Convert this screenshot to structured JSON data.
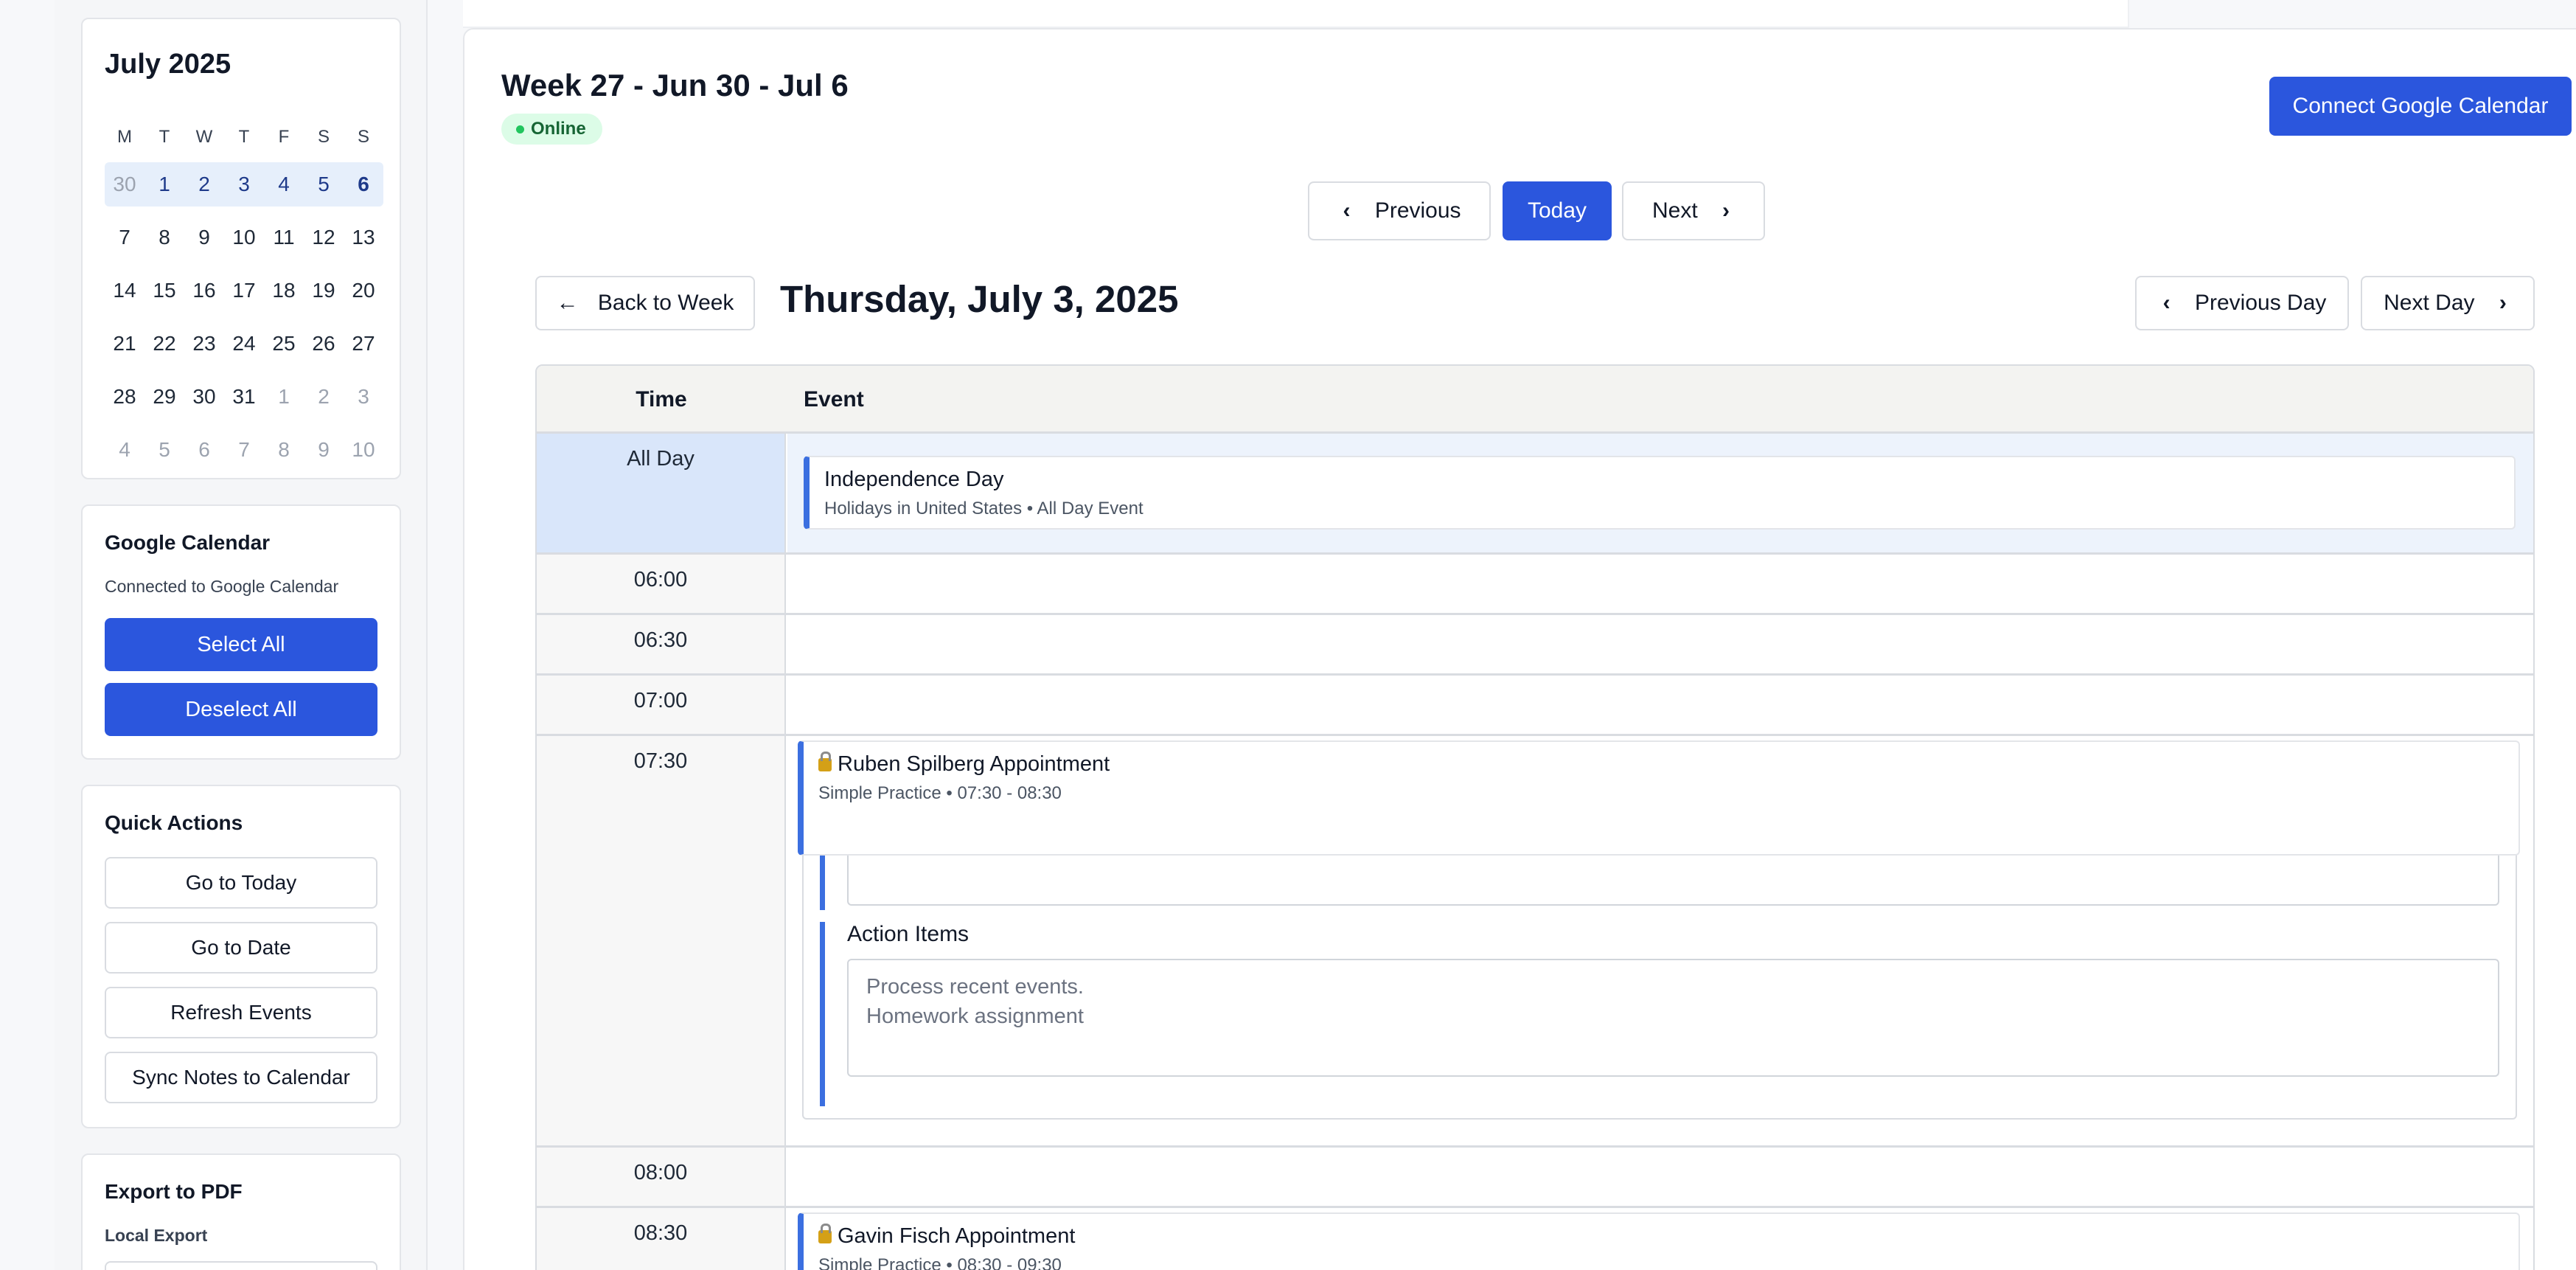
{
  "sidebar": {
    "mini_calendar": {
      "title": "July 2025",
      "weekdays": [
        "M",
        "T",
        "W",
        "T",
        "F",
        "S",
        "S"
      ],
      "weeks": [
        [
          "30",
          "1",
          "2",
          "3",
          "4",
          "5",
          "6"
        ],
        [
          "7",
          "8",
          "9",
          "10",
          "11",
          "12",
          "13"
        ],
        [
          "14",
          "15",
          "16",
          "17",
          "18",
          "19",
          "20"
        ],
        [
          "21",
          "22",
          "23",
          "24",
          "25",
          "26",
          "27"
        ],
        [
          "28",
          "29",
          "30",
          "31",
          "1",
          "2",
          "3"
        ],
        [
          "4",
          "5",
          "6",
          "7",
          "8",
          "9",
          "10"
        ]
      ]
    },
    "google_calendar": {
      "title": "Google Calendar",
      "status": "Connected to Google Calendar",
      "select_all": "Select All",
      "deselect_all": "Deselect All"
    },
    "quick_actions": {
      "title": "Quick Actions",
      "go_today": "Go to Today",
      "go_date": "Go to Date",
      "refresh": "Refresh Events",
      "sync_notes": "Sync Notes to Calendar"
    },
    "export_pdf": {
      "title": "Export to PDF",
      "local_export": "Local Export"
    }
  },
  "header": {
    "week_title": "Week 27 - Jun 30 - Jul 6",
    "status": "Online",
    "connect_button": "Connect Google Calendar"
  },
  "week_nav": {
    "previous": "Previous",
    "today": "Today",
    "next": "Next"
  },
  "day_view": {
    "back_button": "Back to Week",
    "title": "Thursday, July 3, 2025",
    "previous_day": "Previous Day",
    "next_day": "Next Day",
    "columns": {
      "time": "Time",
      "event": "Event"
    },
    "all_day_label": "All Day",
    "all_day_event": {
      "title": "Independence Day",
      "subtitle": "Holidays in United States • All Day Event"
    },
    "slots": [
      "06:00",
      "06:30",
      "07:00",
      "07:30",
      "08:00",
      "08:30"
    ],
    "events": [
      {
        "title": "Ruben Spilberg Appointment",
        "subtitle": "Simple Practice • 07:30 - 08:30",
        "action_items_label": "Action Items",
        "action_items_text": "Process recent events.\nHomework assignment"
      },
      {
        "title": "Gavin Fisch Appointment",
        "subtitle": "Simple Practice • 08:30 - 09:30"
      }
    ]
  },
  "colors": {
    "accent": "#2b56dd",
    "event_border": "#3b6fe0",
    "online_bg": "#dcfce7",
    "online_dot": "#22c55e",
    "all_day_bg": "#d9e6fa"
  }
}
